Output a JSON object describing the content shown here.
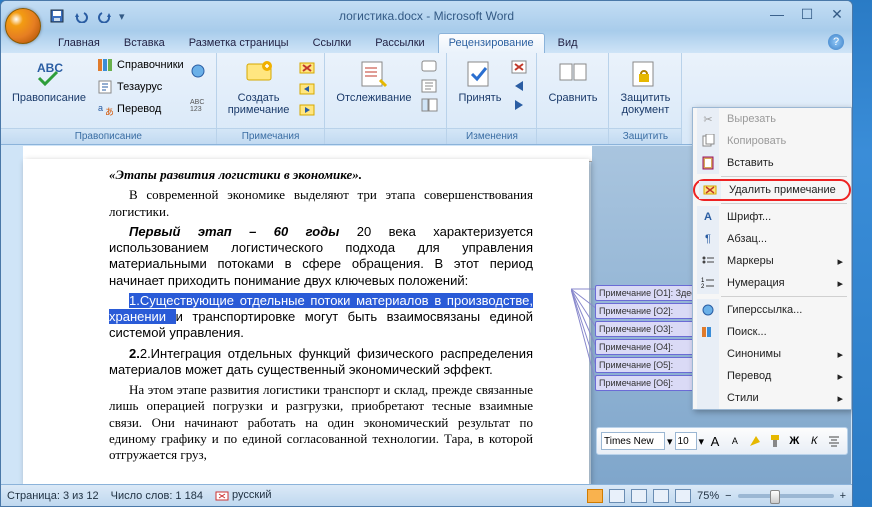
{
  "title": "логистика.docx - Microsoft Word",
  "qat": {
    "save": "save",
    "undo": "undo",
    "redo": "redo"
  },
  "tabs": [
    "Главная",
    "Вставка",
    "Разметка страницы",
    "Ссылки",
    "Рассылки",
    "Рецензирование",
    "Вид"
  ],
  "active_tab": 5,
  "ribbon": {
    "proofing": {
      "title": "Правописание",
      "spelling": "Правописание",
      "research": "Справочники",
      "thesaurus": "Тезаурус",
      "translate": "Перевод"
    },
    "comments": {
      "title": "Примечания",
      "new_comment": "Создать\nпримечание"
    },
    "tracking": {
      "title": "",
      "track": "Отслеживание"
    },
    "changes": {
      "title": "Изменения",
      "accept": "Принять"
    },
    "compare": {
      "title": "",
      "compare": "Сравнить"
    },
    "protect": {
      "title": "Защитить",
      "protect": "Защитить\nдокумент"
    }
  },
  "document": {
    "heading": "«Этапы развития логистики в экономике».",
    "p1": "В современной экономике выделяют три этапа совершенствования логистики.",
    "p2_lead": "Первый этап – 60 годы",
    "p2_rest": " 20 века характеризуется использованием логистического подхода для управления материальными потоками в сфере обращения. В этот период начинает приходить понимание двух ключевых положений:",
    "p3_sel_a": "1.Существующие отдельные потоки материалов ",
    "p3_sel_b": "в производстве, хранении ",
    "p3_rest": "и транспортировке могут быть взаимосвязаны единой системой управления.",
    "p4": "2.Интеграция отдельных функций физического распределения материалов может дать существенный экономический эффект.",
    "p5": "На этом этапе развития логистики транспорт и склад, прежде связанные лишь операцией погрузки и разгрузки, приобретают тесные взаимные связи. Они начинают работать на один экономический результат по единому графику и по единой согласованной технологии. Тара, в которой отгружается груз,"
  },
  "comment_balloons": [
    "Примечание [O1]: Здесь",
    "Примечание [O2]:",
    "Примечание [O3]:",
    "Примечание [O4]:",
    "Примечание [O5]:",
    "Примечание [O6]:"
  ],
  "context_menu": {
    "cut": "Вырезать",
    "copy": "Копировать",
    "paste": "Вставить",
    "delete_comment": "Удалить примечание",
    "font": "Шрифт...",
    "paragraph": "Абзац...",
    "bullets": "Маркеры",
    "numbering": "Нумерация",
    "hyperlink": "Гиперссылка...",
    "lookup": "Поиск...",
    "synonyms": "Синонимы",
    "translate": "Перевод",
    "styles": "Стили"
  },
  "mini_toolbar": {
    "font": "Times New",
    "size": "10"
  },
  "statusbar": {
    "page": "Страница: 3 из 12",
    "words": "Число слов: 1 184",
    "lang": "русский",
    "zoom": "75%"
  }
}
